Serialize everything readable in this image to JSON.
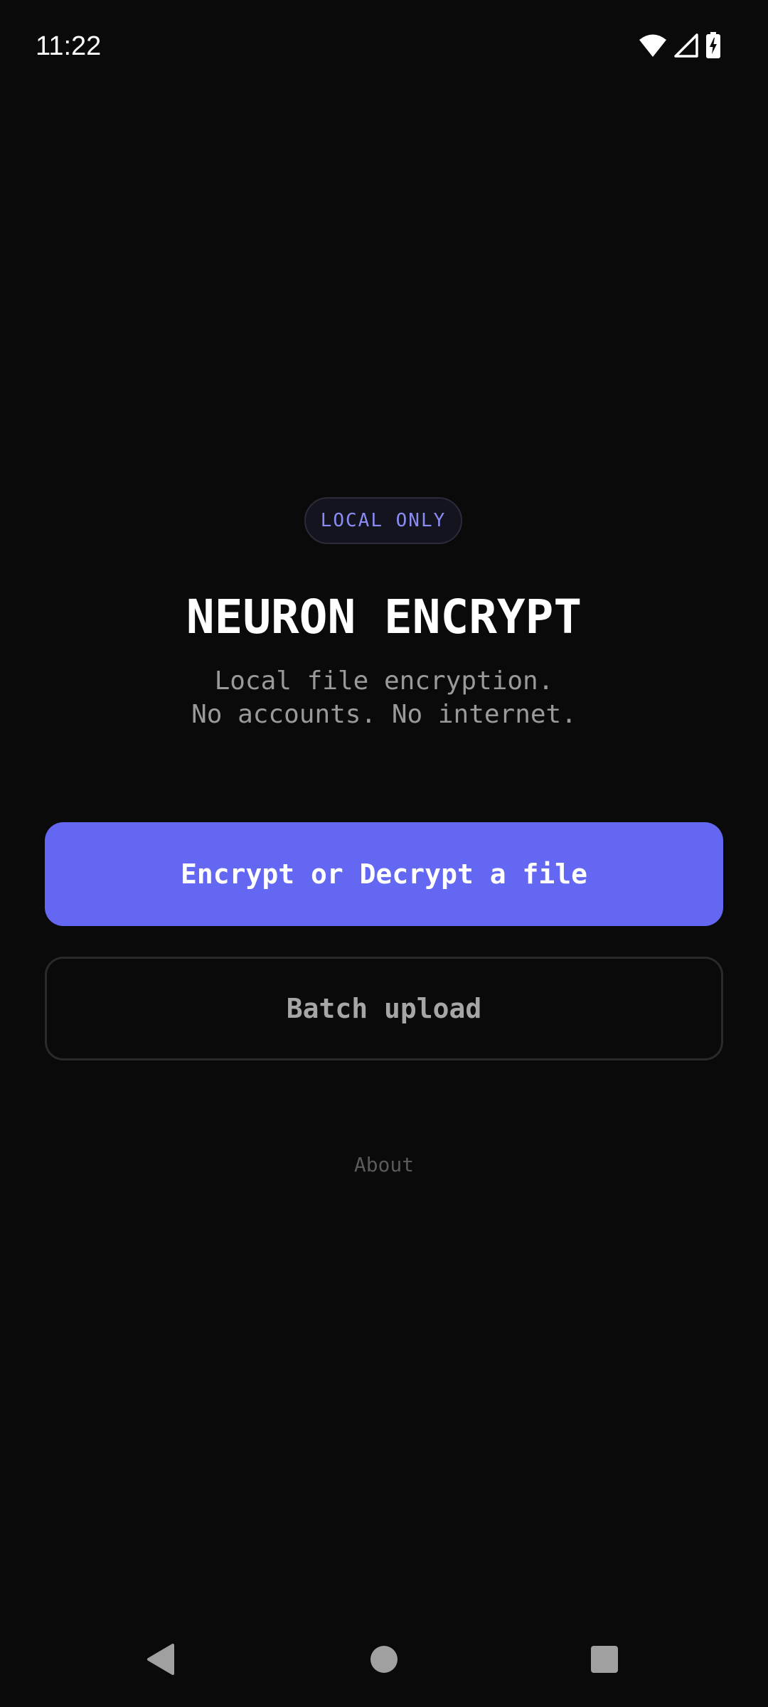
{
  "status_bar": {
    "time": "11:22",
    "icons": [
      "wifi-icon",
      "cellular-signal-icon",
      "battery-charging-icon"
    ]
  },
  "main": {
    "badge": "LOCAL ONLY",
    "title": "NEURON ENCRYPT",
    "subtitle_line1": "Local file encryption.",
    "subtitle_line2": "No accounts. No internet.",
    "primary_button_label": "Encrypt or Decrypt a file",
    "secondary_button_label": "Batch upload",
    "about_label": "About"
  },
  "nav_bar": {
    "icons": [
      "back-icon",
      "home-icon",
      "recents-icon"
    ]
  },
  "colors": {
    "background": "#0a0a0a",
    "accent": "#6467f2",
    "badge_text": "#8a8cf3",
    "muted_text": "#9a9a9a"
  }
}
